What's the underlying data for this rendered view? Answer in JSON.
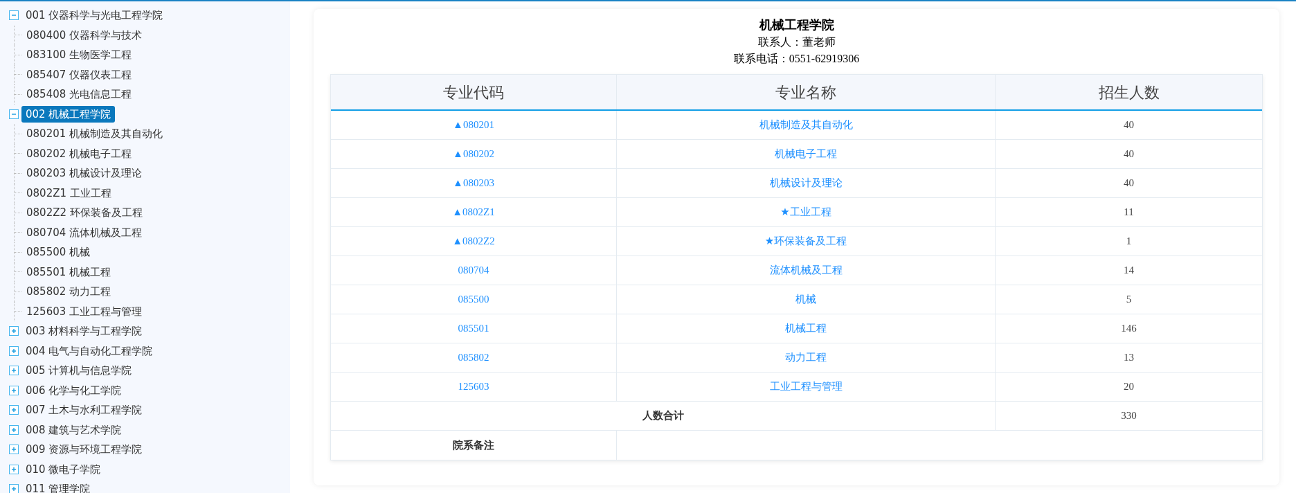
{
  "sidebar": {
    "tree": [
      {
        "label": "001 仪器科学与光电工程学院",
        "expanded": true,
        "selected": false,
        "children": [
          {
            "label": "080400 仪器科学与技术"
          },
          {
            "label": "083100 生物医学工程"
          },
          {
            "label": "085407 仪器仪表工程"
          },
          {
            "label": "085408 光电信息工程"
          }
        ]
      },
      {
        "label": "002 机械工程学院",
        "expanded": true,
        "selected": true,
        "children": [
          {
            "label": "080201 机械制造及其自动化"
          },
          {
            "label": "080202 机械电子工程"
          },
          {
            "label": "080203 机械设计及理论"
          },
          {
            "label": "0802Z1 工业工程"
          },
          {
            "label": "0802Z2 环保装备及工程"
          },
          {
            "label": "080704 流体机械及工程"
          },
          {
            "label": "085500 机械"
          },
          {
            "label": "085501 机械工程"
          },
          {
            "label": "085802 动力工程"
          },
          {
            "label": "125603 工业工程与管理"
          }
        ]
      },
      {
        "label": "003 材料科学与工程学院",
        "expanded": false,
        "selected": false
      },
      {
        "label": "004 电气与自动化工程学院",
        "expanded": false,
        "selected": false
      },
      {
        "label": "005 计算机与信息学院",
        "expanded": false,
        "selected": false
      },
      {
        "label": "006 化学与化工学院",
        "expanded": false,
        "selected": false
      },
      {
        "label": "007 土木与水利工程学院",
        "expanded": false,
        "selected": false
      },
      {
        "label": "008 建筑与艺术学院",
        "expanded": false,
        "selected": false
      },
      {
        "label": "009 资源与环境工程学院",
        "expanded": false,
        "selected": false
      },
      {
        "label": "010 微电子学院",
        "expanded": false,
        "selected": false
      },
      {
        "label": "011 管理学院",
        "expanded": false,
        "selected": false
      }
    ]
  },
  "detail": {
    "title": "机械工程学院",
    "contact": "联系人：董老师",
    "phone": "联系电话：0551-62919306",
    "table": {
      "columns": [
        "专业代码",
        "专业名称",
        "招生人数"
      ],
      "rows": [
        {
          "code": "▲080201",
          "name": "机械制造及其自动化",
          "count": "40"
        },
        {
          "code": "▲080202",
          "name": "机械电子工程",
          "count": "40"
        },
        {
          "code": "▲080203",
          "name": "机械设计及理论",
          "count": "40"
        },
        {
          "code": "▲0802Z1",
          "name": "★工业工程",
          "count": "11"
        },
        {
          "code": "▲0802Z2",
          "name": "★环保装备及工程",
          "count": "1"
        },
        {
          "code": "080704",
          "name": "流体机械及工程",
          "count": "14"
        },
        {
          "code": "085500",
          "name": "机械",
          "count": "5"
        },
        {
          "code": "085501",
          "name": "机械工程",
          "count": "146"
        },
        {
          "code": "085802",
          "name": "动力工程",
          "count": "13"
        },
        {
          "code": "125603",
          "name": "工业工程与管理",
          "count": "20"
        }
      ],
      "total": {
        "label": "人数合计",
        "value": "330"
      },
      "remark": {
        "label": "院系备注"
      }
    }
  }
}
